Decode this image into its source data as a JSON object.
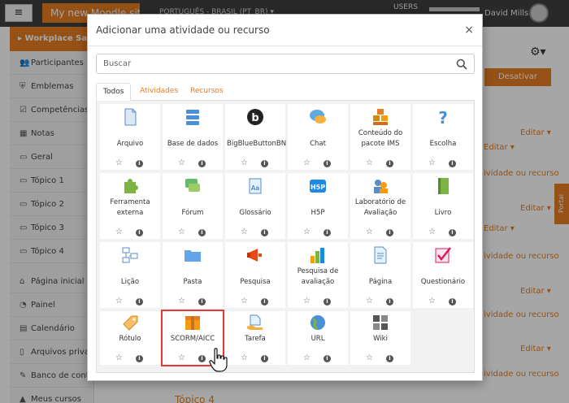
{
  "header": {
    "menu_icon": "hamburger-icon",
    "site_name": "My new Moodle site",
    "language": "PORTUGUÊS - BRASIL (PT_BR) ▾",
    "users_label": "USERS",
    "user_name": "David Mills"
  },
  "sidebar": {
    "course": "Workplace Safety",
    "items": [
      {
        "icon": "users-icon",
        "label": "Participantes"
      },
      {
        "icon": "shield-icon",
        "label": "Emblemas"
      },
      {
        "icon": "check-square-icon",
        "label": "Competências"
      },
      {
        "icon": "table-icon",
        "label": "Notas"
      },
      {
        "icon": "folder-icon",
        "label": "Geral"
      },
      {
        "icon": "folder-icon",
        "label": "Tópico 1"
      },
      {
        "icon": "folder-icon",
        "label": "Tópico 2"
      },
      {
        "icon": "folder-icon",
        "label": "Tópico 3"
      },
      {
        "icon": "folder-icon",
        "label": "Tópico 4"
      },
      {
        "icon": "home-icon",
        "label": "Página inicial"
      },
      {
        "icon": "dashboard-icon",
        "label": "Painel"
      },
      {
        "icon": "calendar-icon",
        "label": "Calendário"
      },
      {
        "icon": "file-icon",
        "label": "Arquivos privados"
      },
      {
        "icon": "pencil-icon",
        "label": "Banco de conteúdo"
      },
      {
        "icon": "graduation-icon",
        "label": "Meus cursos"
      }
    ]
  },
  "page": {
    "deactivate_label": "Desativar edição",
    "edit_label": "Editar ▾",
    "add_activity_label": "ividade ou recurso",
    "portal_label": "Portal",
    "section_label": "Tópico 4"
  },
  "modal": {
    "title": "Adicionar uma atividade ou recurso",
    "close": "×",
    "search_placeholder": "Buscar",
    "tabs": [
      "Todos",
      "Atividades",
      "Recursos"
    ],
    "modules": [
      {
        "label": "Arquivo",
        "icon": "file-icon"
      },
      {
        "label": "Base de dados",
        "icon": "database-icon"
      },
      {
        "label": "BigBlueButtonBN",
        "icon": "bigbluebutton-icon"
      },
      {
        "label": "Chat",
        "icon": "chat-icon"
      },
      {
        "label": "Conteúdo do pacote IMS",
        "icon": "ims-package-icon"
      },
      {
        "label": "Escolha",
        "icon": "question-icon"
      },
      {
        "label": "Ferramenta externa",
        "icon": "puzzle-icon"
      },
      {
        "label": "Fórum",
        "icon": "forum-icon"
      },
      {
        "label": "Glossário",
        "icon": "glossary-icon"
      },
      {
        "label": "H5P",
        "icon": "h5p-icon"
      },
      {
        "label": "Laboratório de Avaliação",
        "icon": "workshop-icon"
      },
      {
        "label": "Livro",
        "icon": "book-icon"
      },
      {
        "label": "Lição",
        "icon": "lesson-icon"
      },
      {
        "label": "Pasta",
        "icon": "folder-icon"
      },
      {
        "label": "Pesquisa",
        "icon": "megaphone-icon"
      },
      {
        "label": "Pesquisa de avaliação",
        "icon": "bar-chart-icon"
      },
      {
        "label": "Página",
        "icon": "page-icon"
      },
      {
        "label": "Questionário",
        "icon": "quiz-icon"
      },
      {
        "label": "Rótulo",
        "icon": "label-tag-icon"
      },
      {
        "label": "SCORM/AICC",
        "icon": "scorm-box-icon"
      },
      {
        "label": "Tarefa",
        "icon": "assignment-icon"
      },
      {
        "label": "URL",
        "icon": "globe-icon"
      },
      {
        "label": "Wiki",
        "icon": "wiki-icon"
      }
    ],
    "info_glyph": "i",
    "star_glyph": "☆"
  },
  "colors": {
    "accent": "#e67e22",
    "highlight_border": "#e53935"
  }
}
